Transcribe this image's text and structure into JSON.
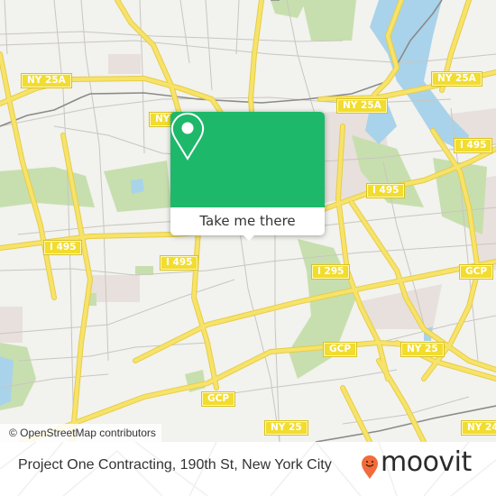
{
  "map": {
    "colors": {
      "background": "#f2f2ee",
      "highway": "#f7e36a",
      "highway_casing": "#e6cd45",
      "minor_road": "#c9c6c0",
      "rail": "#8a8a8a",
      "park": "#c7dfae",
      "water": "#a9d3ea",
      "built": "#e8e0dc"
    },
    "shields": [
      {
        "label": "NY 25A",
        "name": "shield-ny25a-west"
      },
      {
        "label": "NY",
        "name": "shield-ny-partial"
      },
      {
        "label": "NY 25A",
        "name": "shield-ny25a-center"
      },
      {
        "label": "NY 25A",
        "name": "shield-ny25a-east"
      },
      {
        "label": "I 495",
        "name": "shield-i495-east"
      },
      {
        "label": "I 495",
        "name": "shield-i495-center"
      },
      {
        "label": "I 495",
        "name": "shield-i495-west"
      },
      {
        "label": "I 495",
        "name": "shield-i495-south"
      },
      {
        "label": "I 295",
        "name": "shield-i295"
      },
      {
        "label": "GCP",
        "name": "shield-gcp-east"
      },
      {
        "label": "GCP",
        "name": "shield-gcp-center"
      },
      {
        "label": "NY 25",
        "name": "shield-ny25-center"
      },
      {
        "label": "GCP",
        "name": "shield-gcp-south"
      },
      {
        "label": "NY 25",
        "name": "shield-ny25-south"
      },
      {
        "label": "NY 24",
        "name": "shield-ny24"
      }
    ],
    "attribution": "© OpenStreetMap contributors"
  },
  "popup": {
    "icon": "map-pin-icon",
    "button_label": "Take me there",
    "accent_color": "#1eb86a"
  },
  "footer": {
    "place_title": "Project One Contracting, 190th St, New York City",
    "logo_text": "moovit",
    "logo_icon": "moovit-smiley-pin-icon",
    "logo_color": "#f26b3a"
  }
}
